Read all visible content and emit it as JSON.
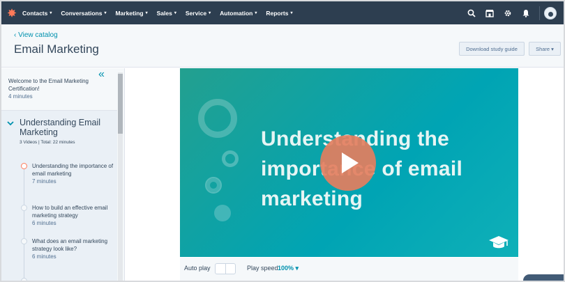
{
  "topnav": {
    "logo_glyph": "✸",
    "items": [
      {
        "label": "Contacts"
      },
      {
        "label": "Conversations"
      },
      {
        "label": "Marketing"
      },
      {
        "label": "Sales"
      },
      {
        "label": "Service"
      },
      {
        "label": "Automation"
      },
      {
        "label": "Reports"
      }
    ],
    "chevron": "⌵",
    "icons": {
      "search": "search-icon",
      "marketplace": "marketplace-icon",
      "settings": "gear-icon",
      "notifications": "bell-icon"
    }
  },
  "header": {
    "back_link": "‹ View catalog",
    "title": "Email Marketing",
    "download_button": "Download study guide",
    "share_button": "Share ▾"
  },
  "sidebar": {
    "collapse_glyph": "«",
    "welcome": {
      "title": "Welcome to the Email Marketing Certification!",
      "duration": "4 minutes"
    },
    "section": {
      "title": "Understanding Email Marketing",
      "meta": "3 Videos | Total: 22 minutes",
      "lessons": [
        {
          "title": "Understanding the importance of email marketing",
          "duration": "7 minutes"
        },
        {
          "title": "How to build an effective email marketing strategy",
          "duration": "6 minutes"
        },
        {
          "title": "What does an email marketing strategy look like?",
          "duration": "6 minutes"
        }
      ]
    }
  },
  "video": {
    "title": "Understanding the importance of email marketing",
    "accent": "#00a4b4",
    "play_color": "#e47e5e"
  },
  "controls": {
    "autoplay_label": "Auto play",
    "speed_label": "Play speed",
    "speed_value": "100% ▾"
  },
  "colors": {
    "nav": "#2d3e50",
    "link": "#0091ae",
    "brand": "#ff7a59"
  }
}
